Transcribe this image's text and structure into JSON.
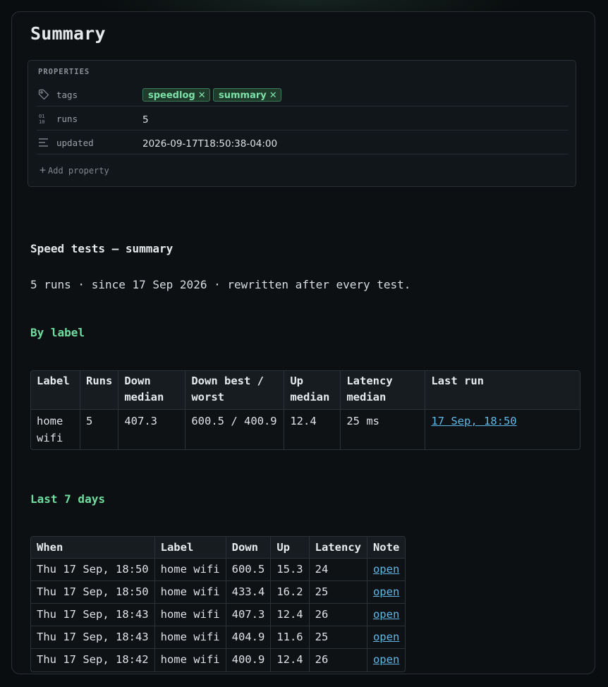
{
  "page": {
    "title": "Summary"
  },
  "properties": {
    "heading": "PROPERTIES",
    "tags_key": "tags",
    "tags": [
      "speedlog",
      "summary"
    ],
    "runs_key": "runs",
    "runs_value": "5",
    "updated_key": "updated",
    "updated_value": "2026-09-17T18:50:38-04:00",
    "add_label": "Add property"
  },
  "doc": {
    "heading": "Speed tests — summary",
    "description": "5 runs · since 17 Sep 2026 · rewritten after every test."
  },
  "by_label": {
    "heading": "By label",
    "columns": [
      "Label",
      "Runs",
      "Down median",
      "Down best / worst",
      "Up median",
      "Latency median",
      "Last run"
    ],
    "rows": [
      {
        "label": "home wifi",
        "runs": "5",
        "down_median": "407.3",
        "down_best_worst": "600.5 / 400.9",
        "up_median": "12.4",
        "latency_median": "25 ms",
        "last_run": "17 Sep, 18:50"
      }
    ]
  },
  "last_7_days": {
    "heading": "Last 7 days",
    "columns": [
      "When",
      "Label",
      "Down",
      "Up",
      "Latency",
      "Note"
    ],
    "rows": [
      {
        "when": "Thu 17 Sep, 18:50",
        "label": "home wifi",
        "down": "600.5",
        "up": "15.3",
        "latency": "24",
        "note": "open"
      },
      {
        "when": "Thu 17 Sep, 18:50",
        "label": "home wifi",
        "down": "433.4",
        "up": "16.2",
        "latency": "25",
        "note": "open"
      },
      {
        "when": "Thu 17 Sep, 18:43",
        "label": "home wifi",
        "down": "407.3",
        "up": "12.4",
        "latency": "26",
        "note": "open"
      },
      {
        "when": "Thu 17 Sep, 18:43",
        "label": "home wifi",
        "down": "404.9",
        "up": "11.6",
        "latency": "25",
        "note": "open"
      },
      {
        "when": "Thu 17 Sep, 18:42",
        "label": "home wifi",
        "down": "400.9",
        "up": "12.4",
        "latency": "26",
        "note": "open"
      }
    ]
  },
  "icons": {
    "tags": "tag-icon",
    "runs": "number-icon",
    "updated": "text-lines-icon",
    "add": "plus-icon",
    "remove_tag": "close-icon"
  },
  "colors": {
    "accent_green": "#6fdca0",
    "link_blue": "#5fb8e8",
    "tag_bg": "#1e3b2c"
  }
}
